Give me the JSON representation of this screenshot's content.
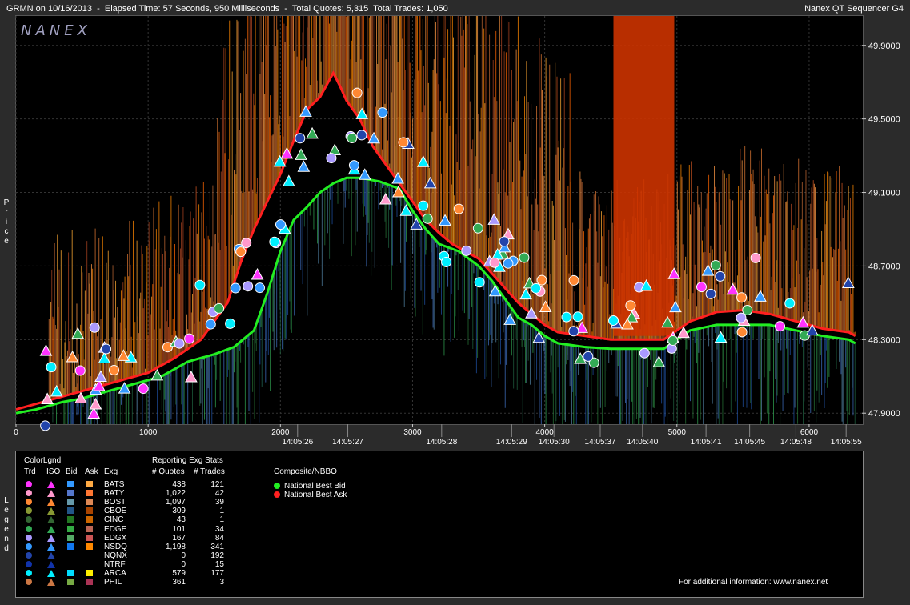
{
  "header": {
    "left_text": "GRMN on 10/16/2013  -  Elapsed Time: 57 Seconds, 950 Milliseconds  -  Total Quotes: 5,315  Total Trades: 1,050",
    "right_text": "Nanex QT Sequencer G4",
    "logo": "NANEX"
  },
  "side_labels": {
    "price": [
      "P",
      "r",
      "i",
      "c",
      "e"
    ],
    "legend": [
      "L",
      "e",
      "g",
      "e",
      "n",
      "d"
    ]
  },
  "chart_data": {
    "type": "line",
    "title": "",
    "xlabel": "",
    "ylabel": "Price",
    "xlim": [
      0,
      6400
    ],
    "ylim": [
      47.84,
      50.06
    ],
    "grid": true,
    "x_ticks": [
      0,
      1000,
      2000,
      3000,
      4000,
      5000,
      6000
    ],
    "y_ticks": [
      "47.9000",
      "48.3000",
      "48.7000",
      "49.1000",
      "49.5000",
      "49.9000"
    ],
    "time_labels": [
      {
        "x": 2130,
        "label": "14:05:26"
      },
      {
        "x": 2510,
        "label": "14:05:27"
      },
      {
        "x": 3220,
        "label": "14:05:28"
      },
      {
        "x": 3750,
        "label": "14:05:29"
      },
      {
        "x": 4070,
        "label": "14:05:30"
      },
      {
        "x": 4420,
        "label": "14:05:37"
      },
      {
        "x": 4740,
        "label": "14:05:40"
      },
      {
        "x": 5220,
        "label": "14:05:41"
      },
      {
        "x": 5550,
        "label": "14:05:45"
      },
      {
        "x": 5900,
        "label": "14:05:48"
      },
      {
        "x": 6280,
        "label": "14:05:55"
      }
    ],
    "series": [
      {
        "name": "National Best Bid",
        "color": "#22ee22",
        "points": [
          [
            0,
            47.9
          ],
          [
            150,
            47.92
          ],
          [
            350,
            47.96
          ],
          [
            500,
            47.98
          ],
          [
            700,
            48.02
          ],
          [
            900,
            48.06
          ],
          [
            1100,
            48.1
          ],
          [
            1300,
            48.18
          ],
          [
            1500,
            48.22
          ],
          [
            1650,
            48.26
          ],
          [
            1800,
            48.35
          ],
          [
            1900,
            48.55
          ],
          [
            2000,
            48.78
          ],
          [
            2100,
            48.95
          ],
          [
            2200,
            49.02
          ],
          [
            2300,
            49.1
          ],
          [
            2400,
            49.15
          ],
          [
            2500,
            49.18
          ],
          [
            2600,
            49.18
          ],
          [
            2750,
            49.16
          ],
          [
            2900,
            49.12
          ],
          [
            3000,
            49.0
          ],
          [
            3100,
            48.9
          ],
          [
            3200,
            48.82
          ],
          [
            3350,
            48.78
          ],
          [
            3500,
            48.7
          ],
          [
            3600,
            48.62
          ],
          [
            3700,
            48.52
          ],
          [
            3800,
            48.42
          ],
          [
            3900,
            48.38
          ],
          [
            4000,
            48.32
          ],
          [
            4100,
            48.28
          ],
          [
            4300,
            48.26
          ],
          [
            4500,
            48.25
          ],
          [
            4700,
            48.25
          ],
          [
            4900,
            48.25
          ],
          [
            5000,
            48.3
          ],
          [
            5100,
            48.35
          ],
          [
            5300,
            48.38
          ],
          [
            5500,
            48.38
          ],
          [
            5700,
            48.38
          ],
          [
            5900,
            48.35
          ],
          [
            6100,
            48.32
          ],
          [
            6300,
            48.3
          ],
          [
            6350,
            48.28
          ]
        ]
      },
      {
        "name": "National Best Ask",
        "color": "#ff2020",
        "points": [
          [
            0,
            47.92
          ],
          [
            200,
            47.96
          ],
          [
            400,
            48.0
          ],
          [
            600,
            48.04
          ],
          [
            800,
            48.08
          ],
          [
            1000,
            48.12
          ],
          [
            1200,
            48.2
          ],
          [
            1400,
            48.3
          ],
          [
            1600,
            48.5
          ],
          [
            1700,
            48.72
          ],
          [
            1800,
            48.9
          ],
          [
            1900,
            49.05
          ],
          [
            2000,
            49.2
          ],
          [
            2100,
            49.38
          ],
          [
            2200,
            49.55
          ],
          [
            2300,
            49.62
          ],
          [
            2400,
            49.75
          ],
          [
            2450,
            49.68
          ],
          [
            2500,
            49.6
          ],
          [
            2600,
            49.5
          ],
          [
            2700,
            49.35
          ],
          [
            2800,
            49.25
          ],
          [
            2900,
            49.15
          ],
          [
            3000,
            49.05
          ],
          [
            3100,
            48.95
          ],
          [
            3200,
            48.88
          ],
          [
            3300,
            48.82
          ],
          [
            3400,
            48.78
          ],
          [
            3500,
            48.74
          ],
          [
            3600,
            48.66
          ],
          [
            3700,
            48.58
          ],
          [
            3800,
            48.5
          ],
          [
            3900,
            48.44
          ],
          [
            4000,
            48.38
          ],
          [
            4100,
            48.34
          ],
          [
            4300,
            48.32
          ],
          [
            4500,
            48.3
          ],
          [
            4700,
            48.3
          ],
          [
            4900,
            48.3
          ],
          [
            5000,
            48.35
          ],
          [
            5100,
            48.4
          ],
          [
            5300,
            48.45
          ],
          [
            5500,
            48.46
          ],
          [
            5700,
            48.44
          ],
          [
            5900,
            48.4
          ],
          [
            6100,
            48.36
          ],
          [
            6300,
            48.34
          ],
          [
            6350,
            48.32
          ]
        ]
      }
    ]
  },
  "legend": {
    "color_legend_title": "ColorLgnd",
    "stats_title": "Reporting Exg Stats",
    "composite_title": "Composite/NBBO",
    "columns": [
      "Trd",
      "ISO",
      "Bid",
      "Ask",
      "Exg",
      "# Quotes",
      "# Trades"
    ],
    "rows": [
      {
        "exg": "BATS",
        "quotes": "438",
        "trades": "121",
        "trd": "#ff33ff",
        "iso": "#ff33ff",
        "bid": "#3399ff",
        "ask": "#ffaa44"
      },
      {
        "exg": "BATY",
        "quotes": "1,022",
        "trades": "42",
        "trd": "#ff99cc",
        "iso": "#ff99cc",
        "bid": "#5577cc",
        "ask": "#ff7733"
      },
      {
        "exg": "BOST",
        "quotes": "1,097",
        "trades": "39",
        "trd": "#ff8833",
        "iso": "#ff8833",
        "bid": "#6699aa",
        "ask": "#dd8855"
      },
      {
        "exg": "CBOE",
        "quotes": "309",
        "trades": "1",
        "trd": "#889933",
        "iso": "#889933",
        "bid": "#225588",
        "ask": "#aa4400"
      },
      {
        "exg": "CINC",
        "quotes": "43",
        "trades": "1",
        "trd": "#336633",
        "iso": "#336633",
        "bid": "#227722",
        "ask": "#cc6600"
      },
      {
        "exg": "EDGE",
        "quotes": "101",
        "trades": "34",
        "trd": "#33aa55",
        "iso": "#33aa55",
        "bid": "#33aa44",
        "ask": "#bb6655"
      },
      {
        "exg": "EDGX",
        "quotes": "167",
        "trades": "84",
        "trd": "#aa99ff",
        "iso": "#aa99ff",
        "bid": "#55aa66",
        "ask": "#cc5555"
      },
      {
        "exg": "NSDQ",
        "quotes": "1,198",
        "trades": "341",
        "trd": "#3399ff",
        "iso": "#3399ff",
        "bid": "#1177ee",
        "ask": "#ff8800"
      },
      {
        "exg": "NQNX",
        "quotes": "0",
        "trades": "192",
        "trd": "#2244aa",
        "iso": "#2244aa",
        "bid": "",
        "ask": ""
      },
      {
        "exg": "NTRF",
        "quotes": "0",
        "trades": "15",
        "trd": "#1133aa",
        "iso": "#1133aa",
        "bid": "",
        "ask": ""
      },
      {
        "exg": "ARCA",
        "quotes": "579",
        "trades": "177",
        "trd": "#00eeff",
        "iso": "#00eeff",
        "bid": "#00ddff",
        "ask": "#ffee00"
      },
      {
        "exg": "PHIL",
        "quotes": "361",
        "trades": "3",
        "trd": "#cc7744",
        "iso": "#cc7744",
        "bid": "#77aa44",
        "ask": "#aa3355"
      }
    ],
    "composite": [
      {
        "label": "National Best Bid",
        "color": "#22ee22"
      },
      {
        "label": "National Best Ask",
        "color": "#ff2020"
      }
    ],
    "footer": "For additional information: www.nanex.net"
  }
}
